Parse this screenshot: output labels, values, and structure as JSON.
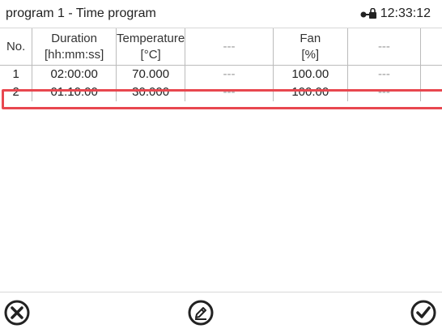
{
  "header": {
    "title": "program 1 - Time program",
    "time": "12:33:12",
    "status_icon": "lock-icon"
  },
  "table": {
    "columns": [
      {
        "top": "No.",
        "bottom": ""
      },
      {
        "top": "Duration",
        "bottom": "[hh:mm:ss]"
      },
      {
        "top": "Temperature",
        "bottom": "[°C]"
      },
      {
        "top": "---",
        "bottom": ""
      },
      {
        "top": "Fan",
        "bottom": "[%]"
      },
      {
        "top": "---",
        "bottom": ""
      },
      {
        "top": "",
        "bottom": ""
      }
    ],
    "rows": [
      [
        "1",
        "02:00:00",
        "70.000",
        "---",
        "100.00",
        "---",
        ""
      ],
      [
        "2",
        "01:10:00",
        "30.000",
        "---",
        "100.00",
        "---",
        ""
      ]
    ],
    "selected_row": 2
  },
  "footer": {
    "buttons": [
      "close-icon",
      "edit-icon",
      "confirm-icon"
    ]
  },
  "colors": {
    "selection": "#e8474f",
    "separator": "#bbbbbb"
  }
}
